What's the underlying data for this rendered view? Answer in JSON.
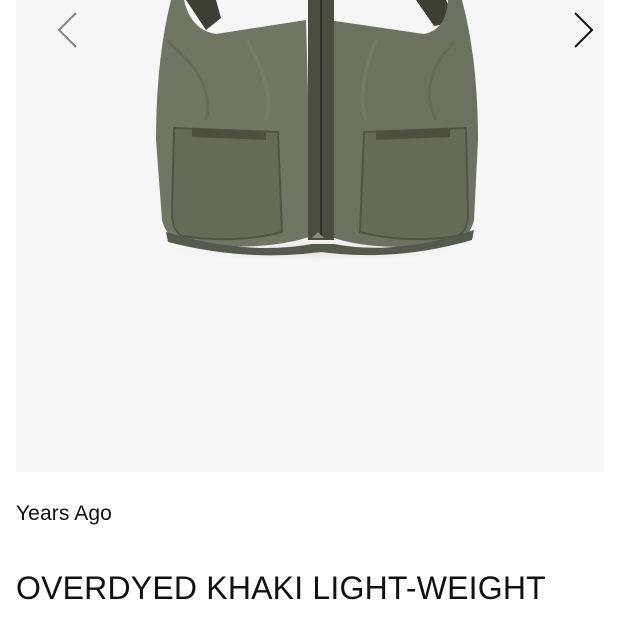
{
  "gallery": {
    "prev_icon": "chevron-left-icon",
    "next_icon": "chevron-right-icon",
    "image_subject": "olive vest",
    "colors": {
      "background": "#f6f6f6",
      "fabric": "#6f7764",
      "fabric_shadow": "#555b4c",
      "lining": "#3d3f33",
      "arrow": "#888888"
    }
  },
  "product": {
    "brand": "Years Ago",
    "title": "OVERDYED KHAKI LIGHT-WEIGHT"
  }
}
